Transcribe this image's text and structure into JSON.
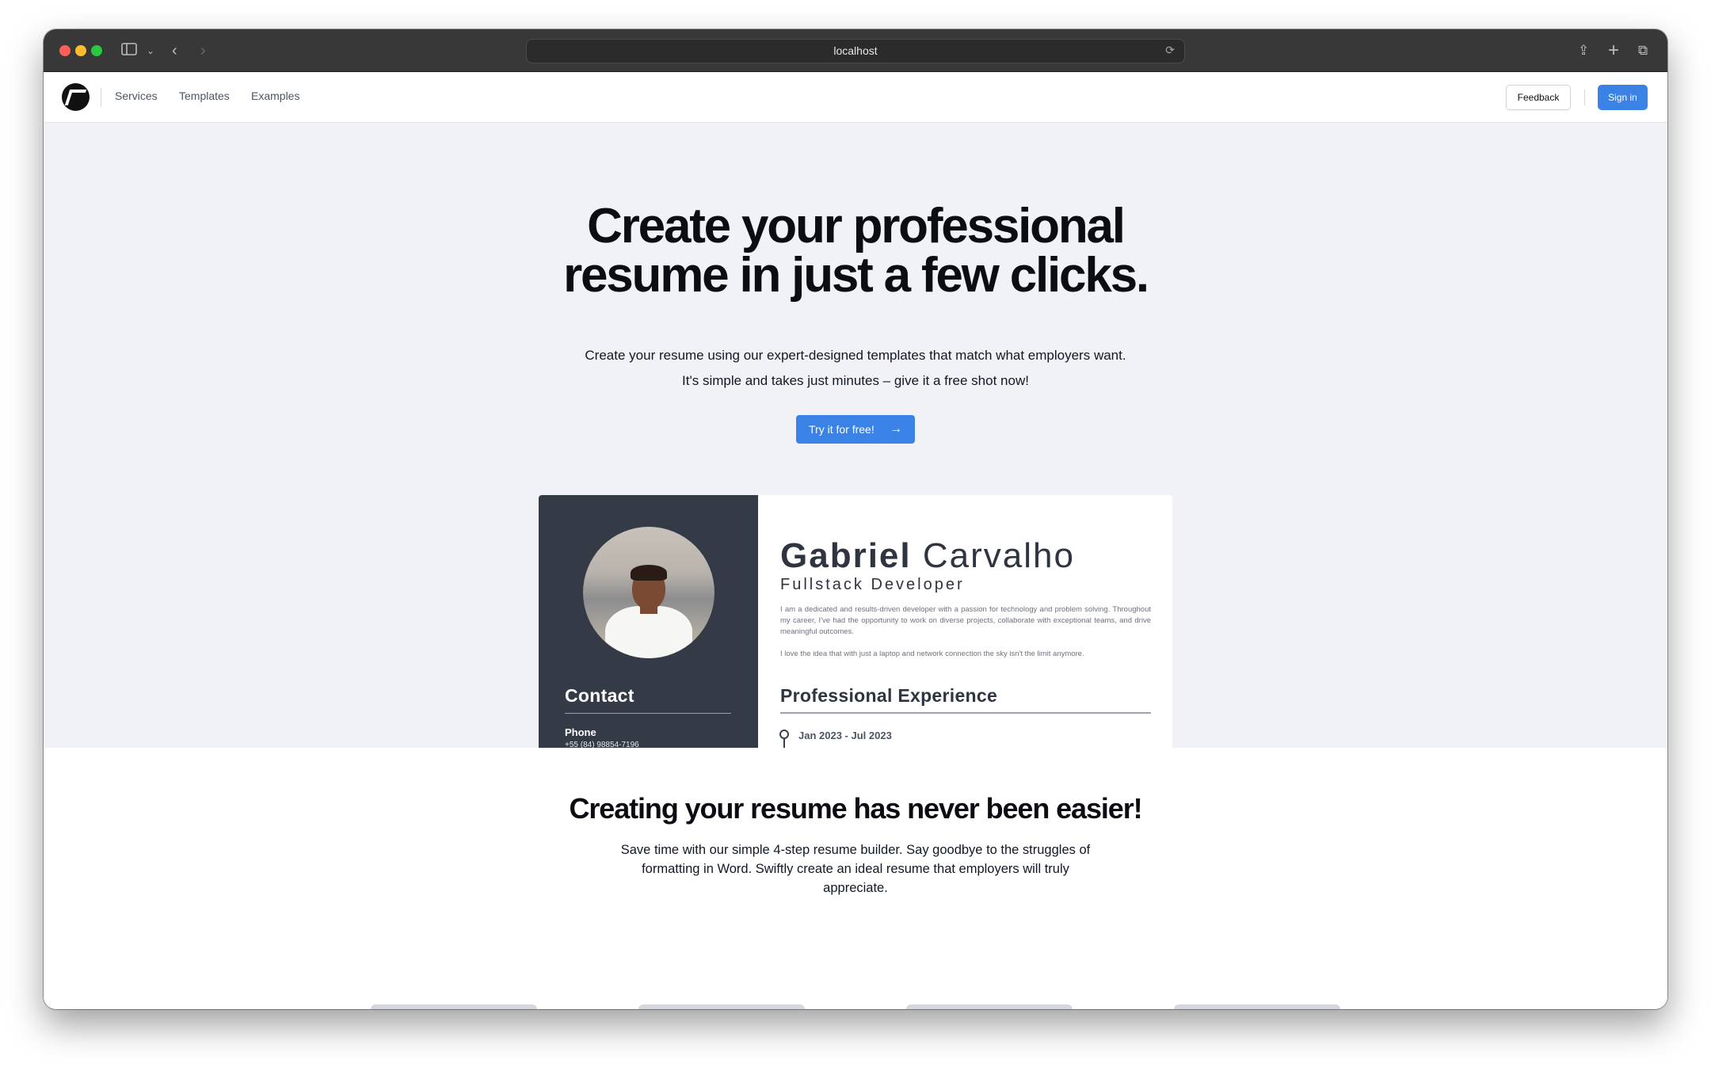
{
  "browser": {
    "url": "localhost"
  },
  "nav": {
    "links": [
      "Services",
      "Templates",
      "Examples"
    ],
    "feedback_label": "Feedback",
    "signin_label": "Sign in"
  },
  "hero": {
    "title": "Create your professional\nresume in just a few clicks.",
    "subtitle_line1": "Create your resume using our expert-designed templates that match what employers want.",
    "subtitle_line2": "It's simple and takes just minutes – give it a free shot now!",
    "cta_label": "Try it for free!"
  },
  "resume": {
    "first_name": "Gabriel",
    "last_name": "Carvalho",
    "job_title": "Fullstack Developer",
    "bio_1": "I am a dedicated and results-driven developer with a passion for technology and problem solving. Throughout my career, I've had the opportunity to work on diverse projects, collaborate with exceptional teams, and drive meaningful outcomes.",
    "bio_2": "I love the idea that with just a laptop and network connection the sky isn't the limit anymore.",
    "contact_heading": "Contact",
    "phone_label": "Phone",
    "phone_value": "+55 (84) 98854-7196",
    "experience_heading": "Professional Experience",
    "experience_date": "Jan 2023 - Jul 2023"
  },
  "section2": {
    "title": "Creating your resume has never been easier!",
    "text": "Save time with our simple 4-step resume builder. Say goodbye to the struggles of formatting in Word. Swiftly create an ideal resume that employers will truly appreciate."
  },
  "colors": {
    "accent": "#3b82e6",
    "hero_bg": "#f1f2f6",
    "resume_sidebar": "#343a46"
  }
}
